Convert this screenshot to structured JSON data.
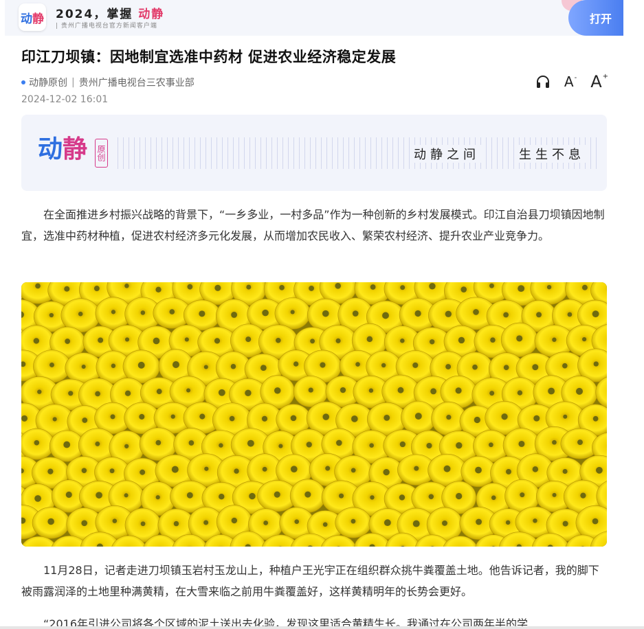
{
  "banner": {
    "app_logo_part1": "动",
    "app_logo_part2": "静",
    "title_text": "2024，掌握",
    "title_accent": "动静",
    "subtitle": "| 贵州广播电视台官方新闻客户端",
    "open_label": "打开",
    "brand_blue": "#2f6fe0",
    "brand_pink": "#e23b6a"
  },
  "article": {
    "title": "印江刀坝镇：因地制宜选准中药材 促进农业经济稳定发展",
    "source_original": "动静原创",
    "source_separator": "|",
    "source_department": "贵州广播电视台三农事业部",
    "date": "2024-12-02 16:01",
    "tools": {
      "listen_icon": "headphones-icon",
      "font_decrease": "A",
      "font_decrease_sup": "-",
      "font_increase": "A",
      "font_increase_sup": "+"
    },
    "brand_card": {
      "logo_part1": "动",
      "logo_part2": "静",
      "badge": "原创",
      "slogan_left": "动静之间",
      "slogan_right": "生生不息"
    },
    "paragraph_1": "在全面推进乡村振兴战略的背景下，“一乡多业，一村多品”作为一种创新的乡村发展模式。印江自治县刀坝镇因地制宜，选准中药材种植，促进农村经济多元化发展，从而增加农民收入、繁荣农村经济、提升农业产业竞争力。",
    "photo_subject": "yellow-chrysanthemum-flowers",
    "paragraph_2": "11月28日，记者走进刀坝镇玉岩村玉龙山上，种植户王光宇正在组织群众挑牛粪覆盖土地。他告诉记者，我的脚下被雨露润泽的土地里种满黄精，在大雪来临之前用牛粪覆盖好，这样黄精明年的长势会更好。",
    "paragraph_3": "“2016年引进公司将各个区域的泥土送出去化验，发现这里适合黄精生长。我通过在公司两年半的学"
  }
}
